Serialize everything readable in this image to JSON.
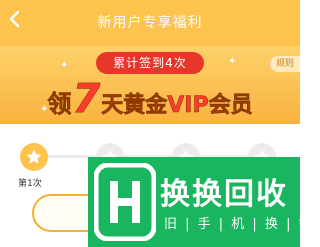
{
  "header": {
    "title": "新用户专享福利"
  },
  "banner": {
    "subtitle": "累计签到4次",
    "main_prefix": "领",
    "main_number": "7",
    "main_suffix": "天黄金VIP会员",
    "rules_label": "规则"
  },
  "checkin": {
    "first_day_label": "第1次",
    "button_label": ""
  },
  "watermark": {
    "title": "换换回收",
    "subtitle": "旧 | 手 | 机 | 换 | 钱"
  },
  "colors": {
    "header_bg": "#fdc34d",
    "banner_red": "#e8372a",
    "accent_yellow": "#f3b032",
    "watermark_green": "#19b55f"
  },
  "icons": {
    "back": "back-arrow-icon",
    "day_done": "star-icon",
    "day_pending": "star-outline-icon",
    "logo": "huanhuan-logo-icon"
  }
}
